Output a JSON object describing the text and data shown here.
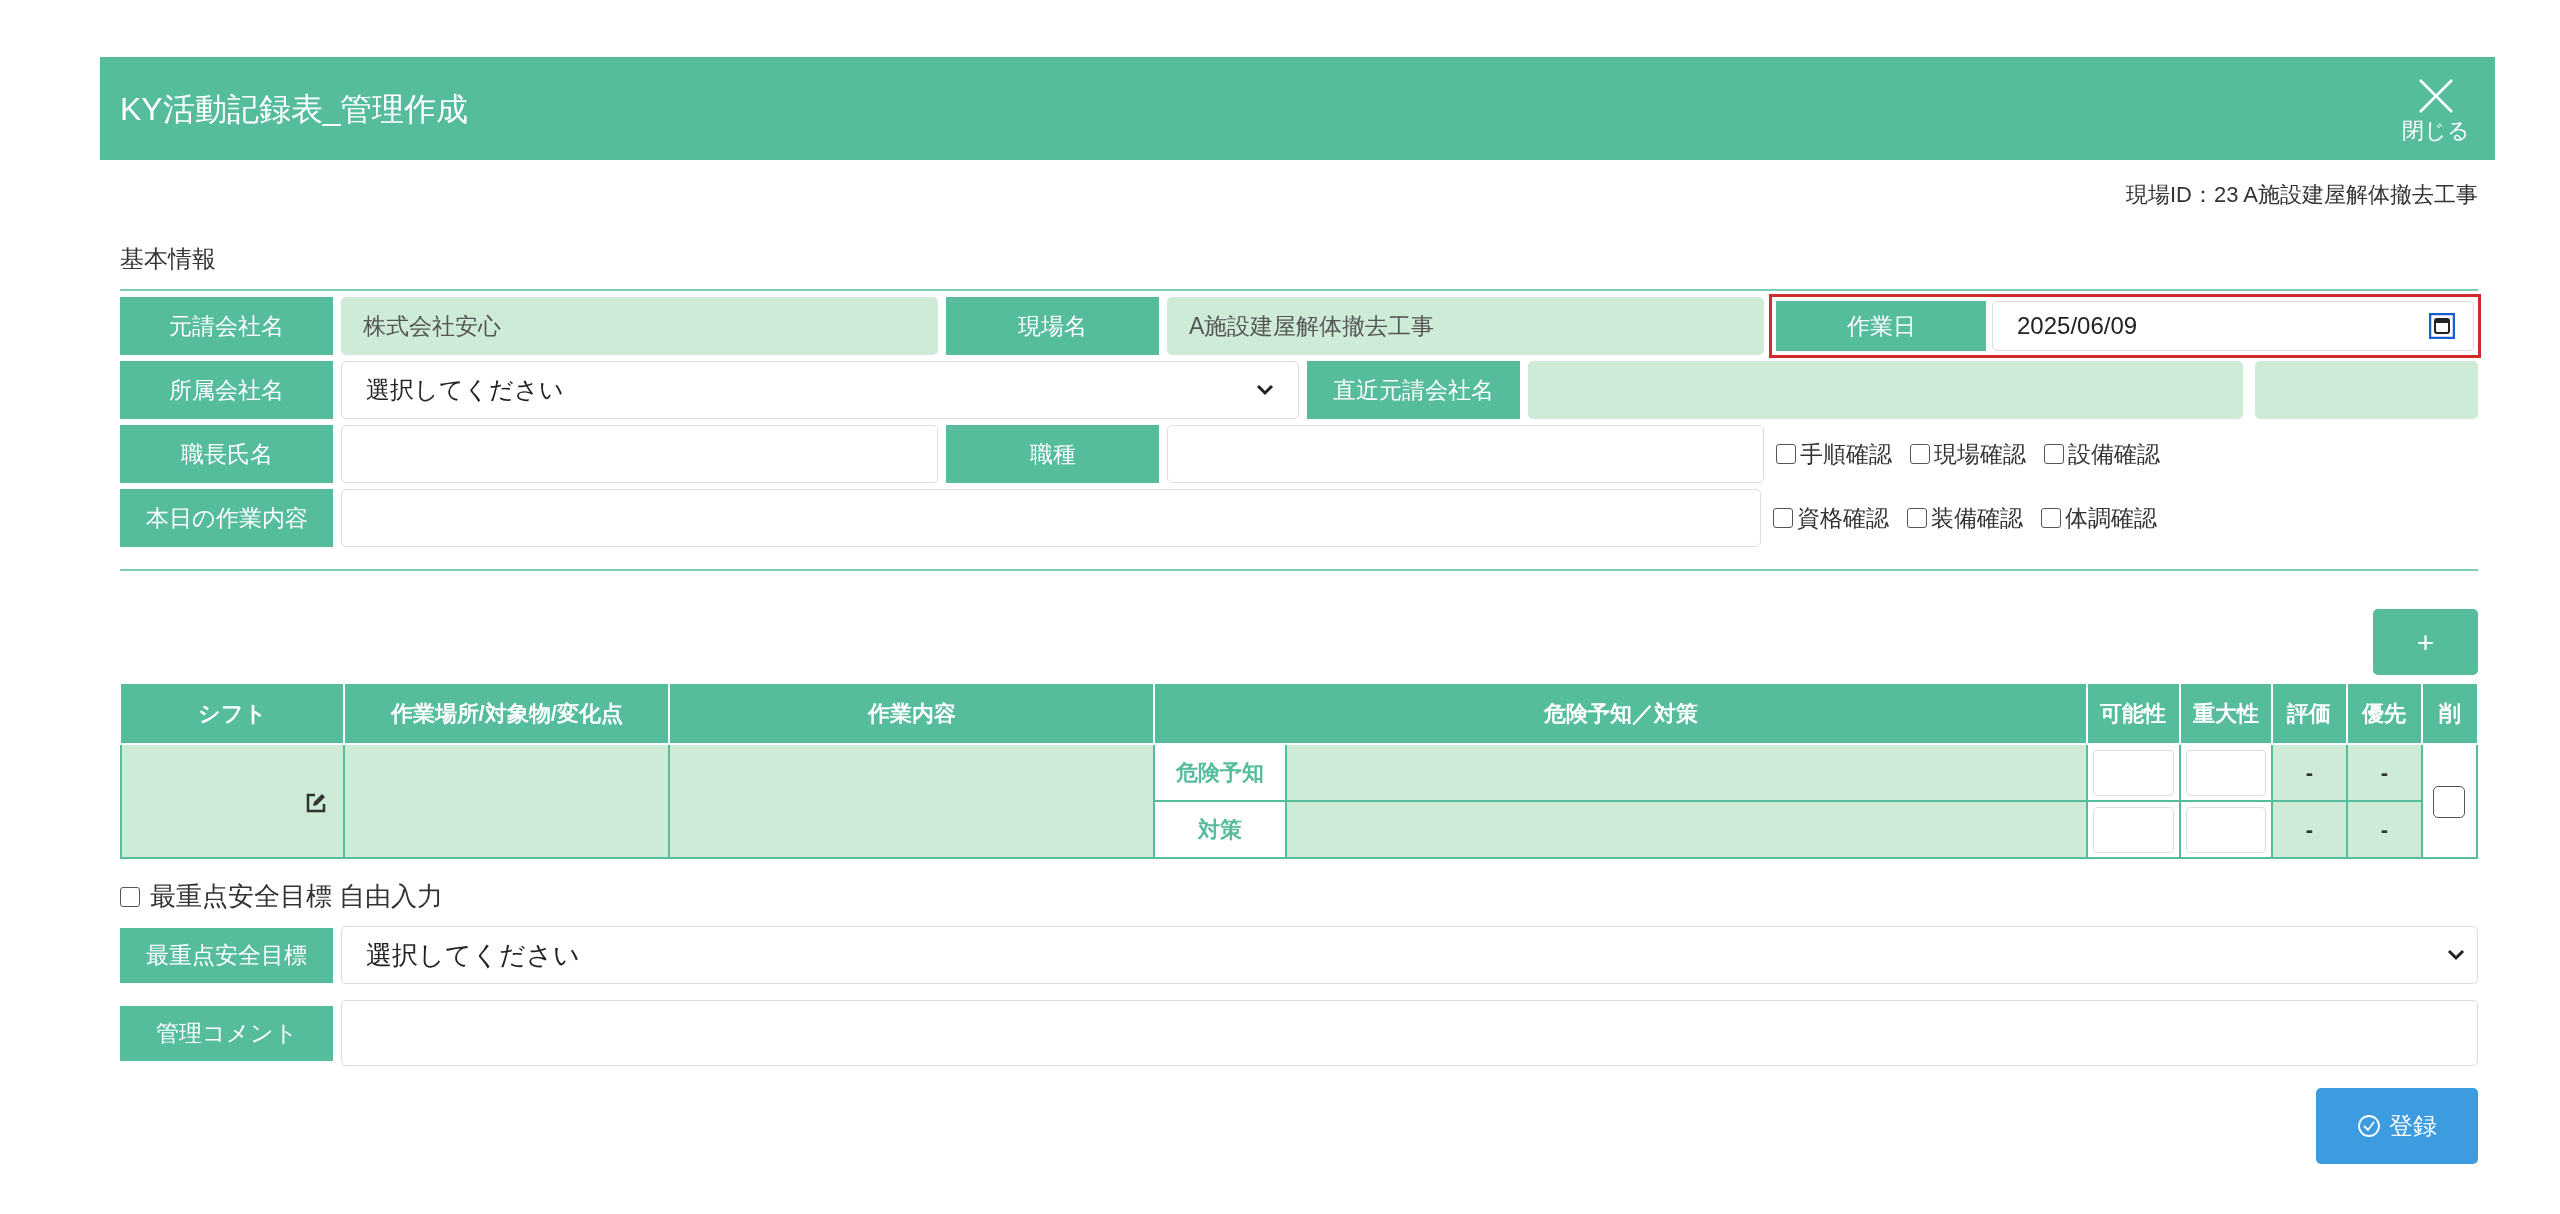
{
  "header": {
    "title": "KY活動記録表_管理作成",
    "close_label": "閉じる"
  },
  "site_id": "現場ID：23 A施設建屋解体撤去工事",
  "basic_info": {
    "heading": "基本情報",
    "rows": [
      {
        "fields": [
          {
            "kind": "readonly",
            "label": "元請会社名",
            "value": "株式会社安心"
          },
          {
            "kind": "readonly",
            "label": "現場名",
            "value": "A施設建屋解体撤去工事"
          },
          {
            "kind": "date",
            "label": "作業日",
            "value": "2025/06/09",
            "highlighted": true
          }
        ]
      },
      {
        "fields": [
          {
            "kind": "select",
            "label": "所属会社名",
            "value": "選択してください"
          },
          {
            "kind": "readonly",
            "label": "直近元請会社名"
          },
          {
            "kind": "readonly"
          }
        ]
      },
      {
        "fields": [
          {
            "kind": "text",
            "label": "職長氏名"
          },
          {
            "kind": "text",
            "label": "職種"
          }
        ],
        "checks": [
          {
            "label": "手順確認",
            "checked": false
          },
          {
            "label": "現場確認",
            "checked": false
          },
          {
            "label": "設備確認",
            "checked": false
          }
        ]
      },
      {
        "fields": [
          {
            "kind": "text",
            "label": "本日の作業内容"
          }
        ],
        "checks": [
          {
            "label": "資格確認",
            "checked": false
          },
          {
            "label": "装備確認",
            "checked": false
          },
          {
            "label": "体調確認",
            "checked": false
          }
        ]
      }
    ]
  },
  "add_button": "+",
  "table": {
    "columns": [
      "シフト",
      "作業場所/対象物/変化点",
      "作業内容",
      "危険予知／対策",
      "可能性",
      "重大性",
      "評価",
      "優先",
      "削"
    ],
    "rows": [
      {
        "delete_checked": false,
        "sub_rows": [
          {
            "label": "危険予知",
            "evaluation": "-",
            "priority": "-"
          },
          {
            "label": "対策",
            "evaluation": "-",
            "priority": "-"
          }
        ]
      }
    ]
  },
  "free_input": {
    "label": "最重点安全目標 自由入力",
    "checked": false
  },
  "safety_goal": {
    "label": "最重点安全目標",
    "value": "選択してください"
  },
  "comment": {
    "label": "管理コメント"
  },
  "submit": "登録"
}
